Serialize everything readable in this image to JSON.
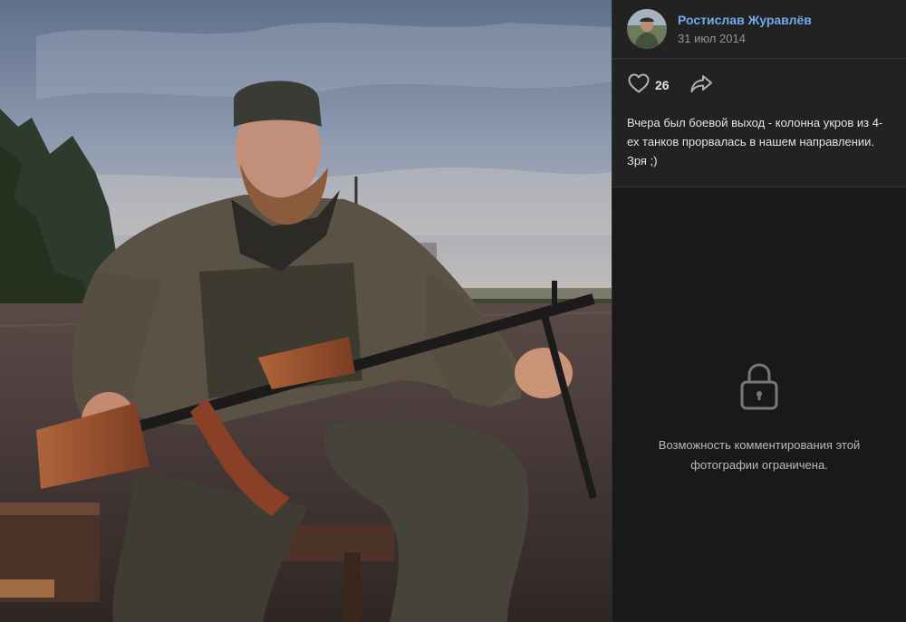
{
  "post": {
    "author_name": "Ростислав Журавлёв",
    "date": "31 июл 2014",
    "likes": "26",
    "caption": "Вчера был боевой выход - колонна укров из 4-ех танков прорвалась в нашем направлении. Зря ;)"
  },
  "comments": {
    "restricted_text": "Возможность комментирования этой фотографии ограничена."
  },
  "icons": {
    "like": "heart-icon",
    "share": "share-arrow-icon",
    "lock": "lock-icon"
  },
  "colors": {
    "link_blue": "#71aaeb",
    "panel_bg": "#222222",
    "comments_bg": "#19191a"
  }
}
